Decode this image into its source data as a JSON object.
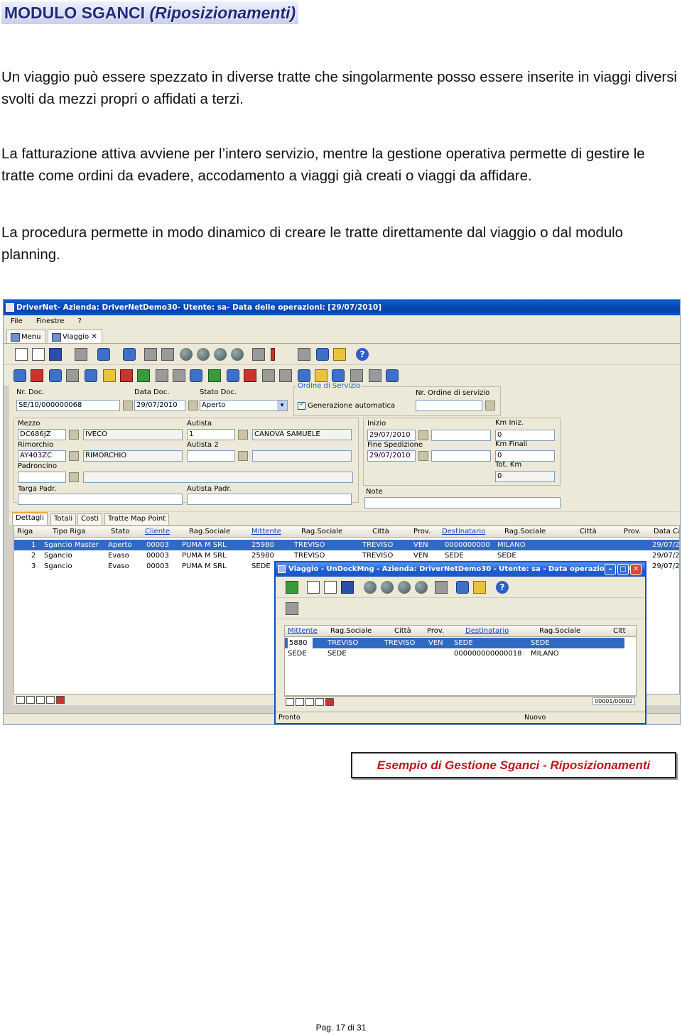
{
  "document": {
    "title_main": "MODULO SGANCI ",
    "title_sub": "(Riposizionamenti)",
    "paragraphs": [
      "Un viaggio può essere spezzato in diverse tratte che singolarmente posso essere inserite in viaggi diversi svolti da mezzi propri o affidati a terzi.",
      "La fatturazione attiva avviene per l’intero servizio, mentre la gestione operativa permette di gestire le tratte come ordini da evadere, accodamento a viaggi già creati o viaggi da affidare.",
      "La procedura permette in modo dinamico di creare le tratte direttamente dal viaggio o dal modulo planning."
    ],
    "caption": "Esempio di Gestione Sganci - Riposizionamenti",
    "page_number": "Pag. 17 di 31"
  },
  "app": {
    "window_title": "DriverNet- Azienda: DriverNetDemo30- Utente: sa- Data delle operazioni: [29/07/2010]",
    "menu": [
      "File",
      "Finestre",
      "?"
    ],
    "tabs": [
      "Menu",
      "Viaggio"
    ],
    "form": {
      "nr_doc_label": "Nr. Doc.",
      "nr_doc_value": "SE/10/000000068",
      "data_doc_label": "Data Doc.",
      "data_doc_value": "29/07/2010",
      "stato_doc_label": "Stato Doc.",
      "stato_doc_value": "Aperto",
      "ordine_group_title": "Ordine di Servizio",
      "generazione_label": "Generazione automatica",
      "nr_ordine_label": "Nr. Ordine di servizio",
      "nr_ordine_value": "",
      "mezzo_label": "Mezzo",
      "mezzo_value": "DC686JZ",
      "mezzo_desc": "IVECO",
      "rimorchio_label": "Rimorchio",
      "rimorchio_value": "AY403ZC",
      "rimorchio_desc": "RIMORCHIO",
      "padroncino_label": "Padroncino",
      "padroncino_value": "",
      "targa_padr_label": "Targa Padr.",
      "autista_label": "Autista",
      "autista_value": "1",
      "autista_desc": "CANOVA SAMUELE",
      "autista2_label": "Autista 2",
      "autista_padr_label": "Autista Padr.",
      "inizio_label": "Inizio",
      "inizio_value": "29/07/2010",
      "fine_label": "Fine Spedizione",
      "fine_value": "29/07/2010",
      "km_iniz_label": "Km Iniz.",
      "km_iniz_value": "0",
      "km_finali_label": "Km Finali",
      "km_finali_value": "0",
      "tot_km_label": "Tot. Km",
      "tot_km_value": "0",
      "note_label": "Note"
    },
    "detail_tabs": [
      "Dettagli",
      "Totali",
      "Costi",
      "Tratte Map Point"
    ],
    "grid": {
      "columns": [
        "Riga",
        "Tipo Riga",
        "Stato",
        "Cliente",
        "Rag.Sociale",
        "Mittente",
        "Rag.Sociale",
        "Città",
        "Prov.",
        "Destinatario",
        "Rag.Sociale",
        "Città",
        "Prov.",
        "Data Ca"
      ],
      "rows": [
        [
          "1",
          "Sgancio Master",
          "Aperto",
          "00003",
          "PUMA M SRL",
          "25980",
          "TREVISO",
          "TREVISO",
          "VEN",
          "0000000000",
          "MILANO",
          "",
          "",
          "29/07/20"
        ],
        [
          "2",
          "Sgancio",
          "Evaso",
          "00003",
          "PUMA M SRL",
          "25980",
          "TREVISO",
          "TREVISO",
          "VEN",
          "SEDE",
          "SEDE",
          "",
          "",
          "29/07/20"
        ],
        [
          "3",
          "Sgancio",
          "Evaso",
          "00003",
          "PUMA M SRL",
          "SEDE",
          "",
          "",
          "",
          "",
          "",
          "",
          "",
          "29/07/20"
        ]
      ]
    },
    "child_window": {
      "title": "Viaggio - UnDockMng - Azienda: DriverNetDemo30 - Utente: sa - Data operazioni: [29/...",
      "columns": [
        "Mittente",
        "Rag.Sociale",
        "Città",
        "Prov.",
        "Destinatario",
        "Rag.Sociale",
        "Citt"
      ],
      "rows": [
        [
          "5880",
          "TREVISO",
          "TREVISO",
          "VEN",
          "SEDE",
          "SEDE"
        ],
        [
          "SEDE",
          "SEDE",
          "",
          "",
          "000000000000018",
          "MILANO"
        ]
      ],
      "record_counter": "00001/00002",
      "status_left": "Pronto",
      "status_right": "Nuovo"
    }
  }
}
